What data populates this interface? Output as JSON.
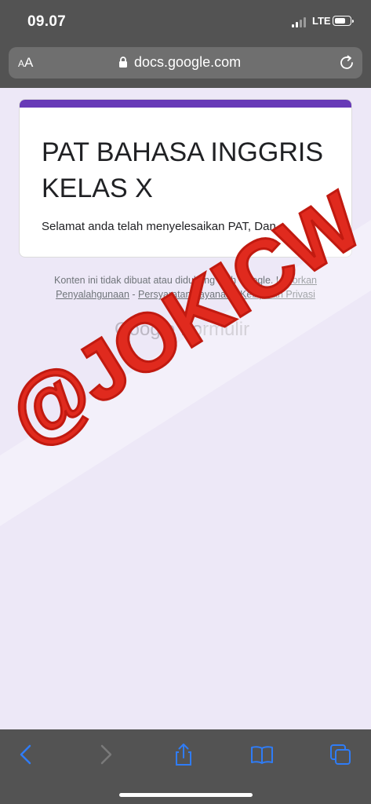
{
  "status_bar": {
    "time": "09.07",
    "network": "LTE"
  },
  "address_bar": {
    "aa_label_small": "A",
    "aa_label_large": "A",
    "url": "docs.google.com"
  },
  "form": {
    "title": "PAT BAHASA INGGRIS KELAS X",
    "message": "Selamat anda telah menyelesaikan PAT, Dan"
  },
  "footer": {
    "disclaimer_text": "Konten ini tidak dibuat atau didukung oleh Google.",
    "report_link": "Laporkan Penyalahgunaan",
    "separator1": " - ",
    "terms_link": "Persyaratan Layanan",
    "separator2": " - ",
    "privacy_link": "Kebijakan Privasi",
    "logo_text": "Google Formulir"
  },
  "watermark": {
    "text": "@JOKICW",
    "color": "#e02a1e"
  },
  "colors": {
    "accent": "#673ab7",
    "toolbar_icon": "#2f7cf6"
  },
  "toolbar": {
    "icons": [
      "back-icon",
      "forward-icon",
      "share-icon",
      "bookmarks-icon",
      "tabs-icon"
    ]
  }
}
